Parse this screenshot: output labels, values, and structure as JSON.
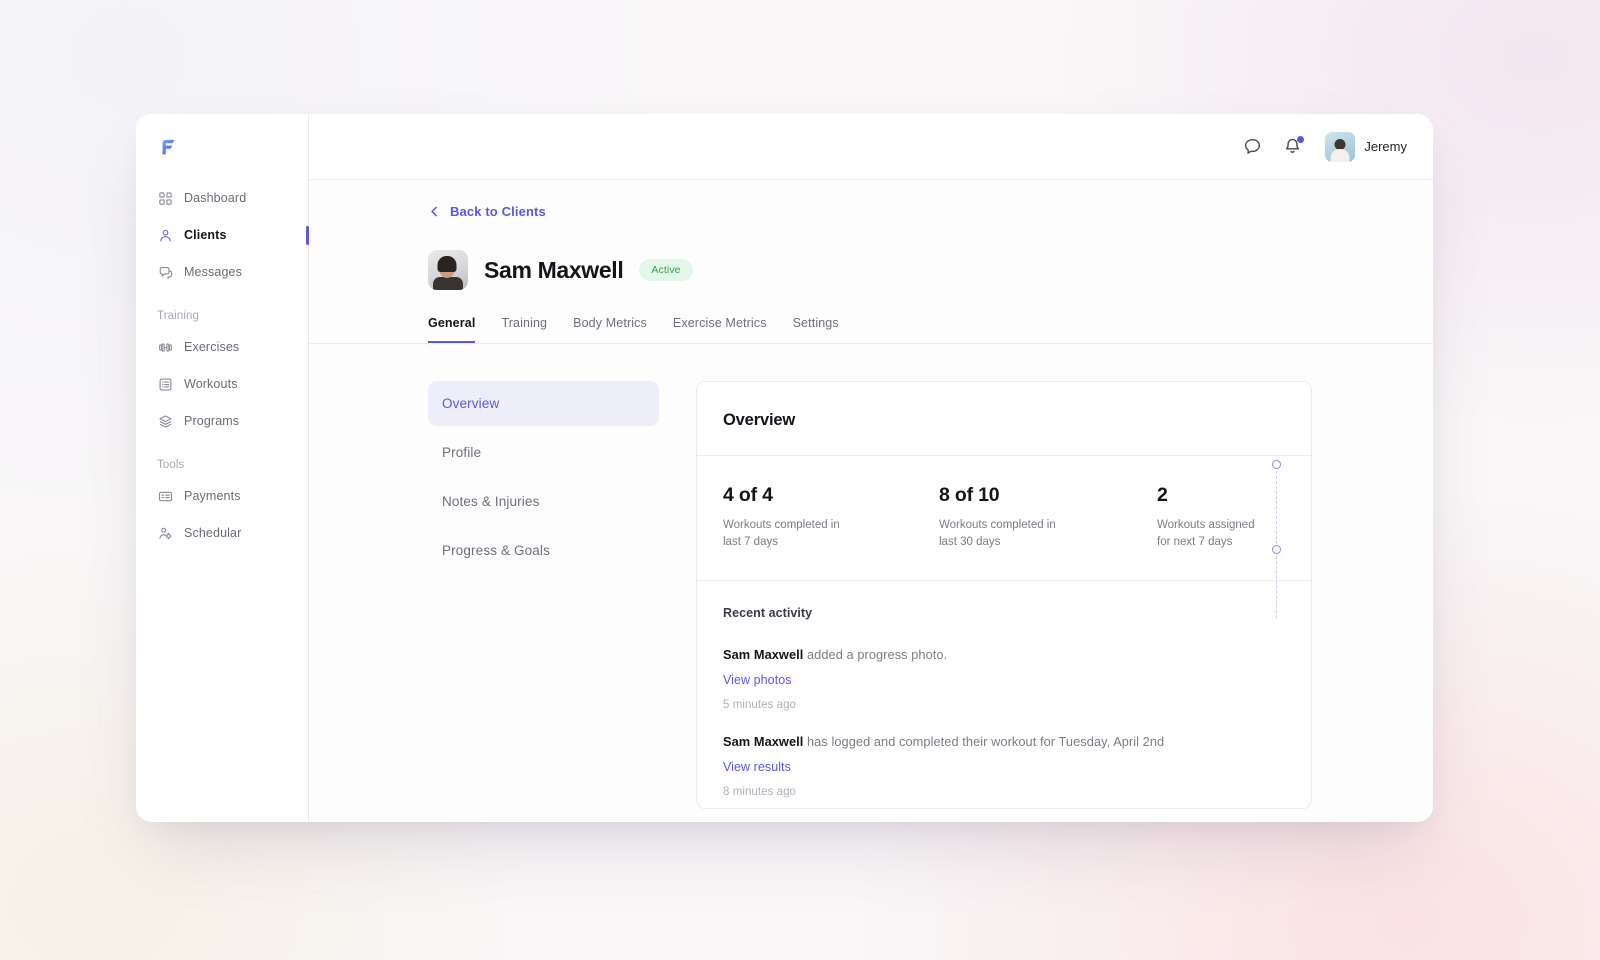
{
  "brand": {
    "logo_icon": "brand-f-logo",
    "accent": "#5b57e0"
  },
  "sidebar": {
    "primary": [
      {
        "label": "Dashboard",
        "icon": "grid-icon",
        "active": false
      },
      {
        "label": "Clients",
        "icon": "user-icon",
        "active": true
      },
      {
        "label": "Messages",
        "icon": "chat-bubbles-icon",
        "active": false
      }
    ],
    "sections": [
      {
        "label": "Training",
        "items": [
          {
            "label": "Exercises",
            "icon": "dumbbell-icon"
          },
          {
            "label": "Workouts",
            "icon": "list-card-icon"
          },
          {
            "label": "Programs",
            "icon": "layers-icon"
          }
        ]
      },
      {
        "label": "Tools",
        "items": [
          {
            "label": "Payments",
            "icon": "id-card-icon"
          },
          {
            "label": "Schedular",
            "icon": "person-settings-icon"
          }
        ]
      }
    ]
  },
  "topbar": {
    "chat_icon": "chat-bubble-icon",
    "bell_icon": "bell-icon",
    "has_notification": true,
    "user_name": "Jeremy",
    "avatar_icon": "user-avatar"
  },
  "page": {
    "back_label": "Back to Clients",
    "back_icon": "chevron-left-icon",
    "client_name": "Sam Maxwell",
    "status": "Active",
    "status_color": "#2e9e55",
    "status_bg": "#e3f8e8",
    "tabs": [
      {
        "label": "General",
        "active": true
      },
      {
        "label": "Training",
        "active": false
      },
      {
        "label": "Body Metrics",
        "active": false
      },
      {
        "label": "Exercise Metrics",
        "active": false
      },
      {
        "label": "Settings",
        "active": false
      }
    ],
    "subnav": [
      {
        "label": "Overview",
        "active": true
      },
      {
        "label": "Profile",
        "active": false
      },
      {
        "label": "Notes & Injuries",
        "active": false
      },
      {
        "label": "Progress & Goals",
        "active": false
      }
    ]
  },
  "overview": {
    "title": "Overview",
    "stats": [
      {
        "value": "4 of 4",
        "label": "Workouts completed in last 7 days"
      },
      {
        "value": "8 of 10",
        "label": "Workouts completed in last 30 days"
      },
      {
        "value": "2",
        "label": "Workouts assigned for next 7 days"
      }
    ],
    "activity_title": "Recent activity",
    "activities": [
      {
        "actor": "Sam Maxwell",
        "text": " added a progress photo.",
        "link": "View photos",
        "time": "5 minutes ago"
      },
      {
        "actor": "Sam Maxwell",
        "text": " has logged and completed their workout for Tuesday, April 2nd",
        "link": "View results",
        "time": "8 minutes ago"
      }
    ]
  }
}
